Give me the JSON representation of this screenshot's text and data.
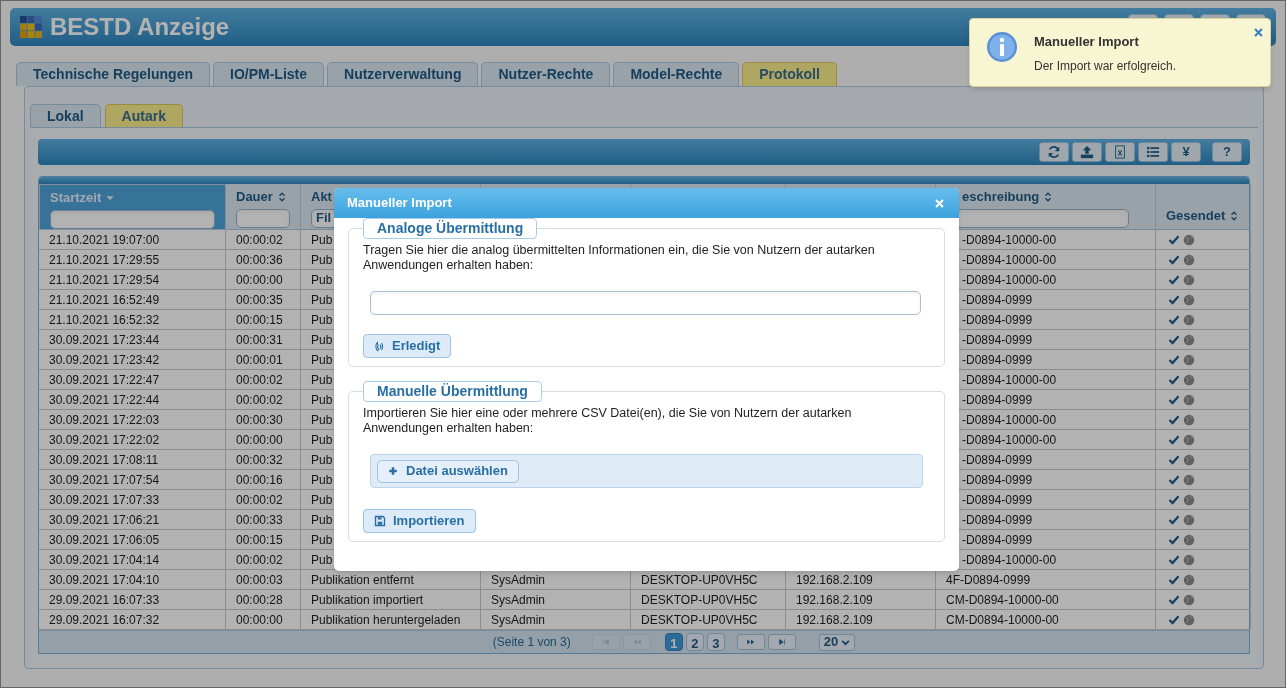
{
  "header": {
    "title": "BESTD Anzeige"
  },
  "notification": {
    "title": "Manueller Import",
    "message": "Der Import war erfolgreich."
  },
  "tabs": [
    {
      "label": "Technische Regelungen",
      "selected": false
    },
    {
      "label": "IO/PM-Liste",
      "selected": false
    },
    {
      "label": "Nutzerverwaltung",
      "selected": false
    },
    {
      "label": "Nutzer-Rechte",
      "selected": false
    },
    {
      "label": "Model-Rechte",
      "selected": false
    },
    {
      "label": "Protokoll",
      "selected": true
    }
  ],
  "subtabs": [
    {
      "label": "Lokal",
      "selected": false
    },
    {
      "label": "Autark",
      "selected": true
    }
  ],
  "toolbar": [
    {
      "kind": "refresh"
    },
    {
      "kind": "upload"
    },
    {
      "kind": "excel"
    },
    {
      "kind": "list"
    },
    {
      "kind": "text",
      "label": "¥"
    },
    {
      "kind": "text",
      "label": "?"
    }
  ],
  "table": {
    "columns": [
      {
        "label": "Startzeit",
        "sorted": true,
        "filter": true
      },
      {
        "label": "Dauer",
        "sorted": false,
        "filter": true
      },
      {
        "label": "Akt",
        "filter": true,
        "placeholder": "Fil"
      },
      {
        "label": "eschreibung",
        "sorted": false,
        "filter": true
      },
      {
        "label": "Gesendet",
        "sorted": false,
        "filter": false
      }
    ],
    "rows": [
      {
        "cells": [
          "21.10.2021 19:07:00",
          "00:00:02",
          "Pub",
          "-D0894-10000-00"
        ]
      },
      {
        "cells": [
          "21.10.2021 17:29:55",
          "00:00:36",
          "Pub",
          "-D0894-10000-00"
        ]
      },
      {
        "cells": [
          "21.10.2021 17:29:54",
          "00:00:00",
          "Pub",
          "-D0894-10000-00"
        ]
      },
      {
        "cells": [
          "21.10.2021 16:52:49",
          "00:00:35",
          "Pub",
          "-D0894-0999"
        ]
      },
      {
        "cells": [
          "21.10.2021 16:52:32",
          "00:00:15",
          "Pub",
          "-D0894-0999"
        ]
      },
      {
        "cells": [
          "30.09.2021 17:23:44",
          "00:00:31",
          "Pub",
          "-D0894-0999"
        ]
      },
      {
        "cells": [
          "30.09.2021 17:23:42",
          "00:00:01",
          "Pub",
          "-D0894-0999"
        ]
      },
      {
        "cells": [
          "30.09.2021 17:22:47",
          "00:00:02",
          "Pub",
          "-D0894-10000-00"
        ]
      },
      {
        "cells": [
          "30.09.2021 17:22:44",
          "00:00:02",
          "Pub",
          "-D0894-0999"
        ]
      },
      {
        "cells": [
          "30.09.2021 17:22:03",
          "00:00:30",
          "Pub",
          "-D0894-10000-00"
        ]
      },
      {
        "cells": [
          "30.09.2021 17:22:02",
          "00:00:00",
          "Pub",
          "-D0894-10000-00"
        ]
      },
      {
        "cells": [
          "30.09.2021 17:08:11",
          "00:00:32",
          "Pub",
          "-D0894-0999"
        ]
      },
      {
        "cells": [
          "30.09.2021 17:07:54",
          "00:00:16",
          "Pub",
          "-D0894-0999"
        ]
      },
      {
        "cells": [
          "30.09.2021 17:07:33",
          "00:00:02",
          "Pub",
          "-D0894-0999"
        ]
      },
      {
        "cells": [
          "30.09.2021 17:06:21",
          "00:00:33",
          "Pub",
          "-D0894-0999"
        ]
      },
      {
        "cells": [
          "30.09.2021 17:06:05",
          "00:00:15",
          "Pub",
          "-D0894-0999"
        ]
      },
      {
        "cells": [
          "30.09.2021 17:04:14",
          "00:00:02",
          "Pub",
          "-D0894-10000-00"
        ]
      },
      {
        "cells": [
          "30.09.2021 17:04:10",
          "00:00:03",
          "Publikation entfernt",
          "SysAdmin",
          "DESKTOP-UP0VH5C",
          "192.168.2.109",
          "4F-D0894-0999"
        ]
      },
      {
        "cells": [
          "29.09.2021 16:07:33",
          "00:00:28",
          "Publikation importiert",
          "SysAdmin",
          "DESKTOP-UP0VH5C",
          "192.168.2.109",
          "CM-D0894-10000-00"
        ]
      },
      {
        "cells": [
          "29.09.2021 16:07:32",
          "00:00:00",
          "Publikation heruntergeladen",
          "SysAdmin",
          "DESKTOP-UP0VH5C",
          "192.168.2.109",
          "CM-D0894-10000-00"
        ]
      }
    ]
  },
  "pager": {
    "info": "(Seite 1 von 3)",
    "nav": [
      {
        "kind": "first",
        "disabled": true
      },
      {
        "kind": "prev",
        "disabled": true
      },
      {
        "kind": "next",
        "disabled": false
      },
      {
        "kind": "last",
        "disabled": false
      }
    ],
    "pages": [
      {
        "label": "1",
        "selected": true
      },
      {
        "label": "2",
        "selected": false
      },
      {
        "label": "3",
        "selected": false
      }
    ],
    "page_size": "20"
  },
  "dialog": {
    "title": "Manueller Import",
    "sections": [
      {
        "kind": "analog",
        "legend": "Analoge Übermittlung",
        "text": "Tragen Sie hier die analog übermittelten Informationen ein, die Sie von Nutzern der autarken Anwendungen erhalten haben:",
        "button": "Erledigt"
      },
      {
        "kind": "files",
        "legend": "Manuelle Übermittlung",
        "text": "Importieren Sie hier eine oder mehrere CSV Datei(en), die Sie von Nutzern der autarken Anwendungen erhalten haben:",
        "button": "Datei auswählen"
      }
    ],
    "submit": "Importieren"
  }
}
